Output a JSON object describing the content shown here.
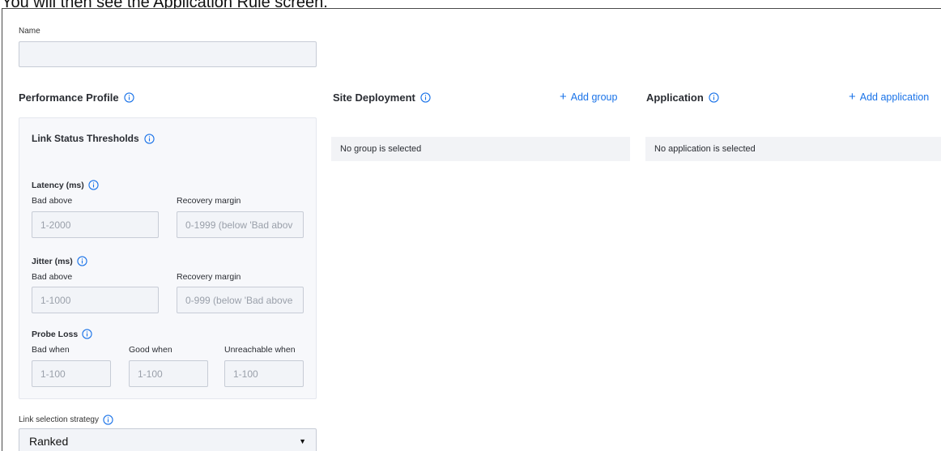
{
  "doc_heading": "You will then see the Application Rule screen.",
  "name_field": {
    "label": "Name",
    "value": ""
  },
  "performance_profile": {
    "title": "Performance Profile",
    "card_title": "Link Status Thresholds",
    "latency": {
      "title": "Latency (ms)",
      "bad_label": "Bad above",
      "bad_placeholder": "1-2000",
      "recovery_label": "Recovery margin",
      "recovery_placeholder": "0-1999 (below 'Bad abov"
    },
    "jitter": {
      "title": "Jitter (ms)",
      "bad_label": "Bad above",
      "bad_placeholder": "1-1000",
      "recovery_label": "Recovery margin",
      "recovery_placeholder": "0-999 (below 'Bad above"
    },
    "probe_loss": {
      "title": "Probe Loss",
      "bad_label": "Bad when",
      "bad_placeholder": "1-100",
      "good_label": "Good when",
      "good_placeholder": "1-100",
      "unreachable_label": "Unreachable when",
      "unreachable_placeholder": "1-100"
    }
  },
  "site_deployment": {
    "title": "Site Deployment",
    "add_label": "Add group",
    "empty_text": "No group is selected"
  },
  "application": {
    "title": "Application",
    "add_label": "Add application",
    "empty_text": "No application is selected"
  },
  "link_strategy": {
    "label": "Link selection strategy",
    "selected": "Ranked"
  },
  "colors": {
    "accent": "#1a73e8",
    "input_bg": "#f2f4f8",
    "card_bg": "#f7f8fb"
  },
  "icons": {
    "info": "info-icon",
    "plus": "plus-icon",
    "caret": "caret-down-icon"
  }
}
